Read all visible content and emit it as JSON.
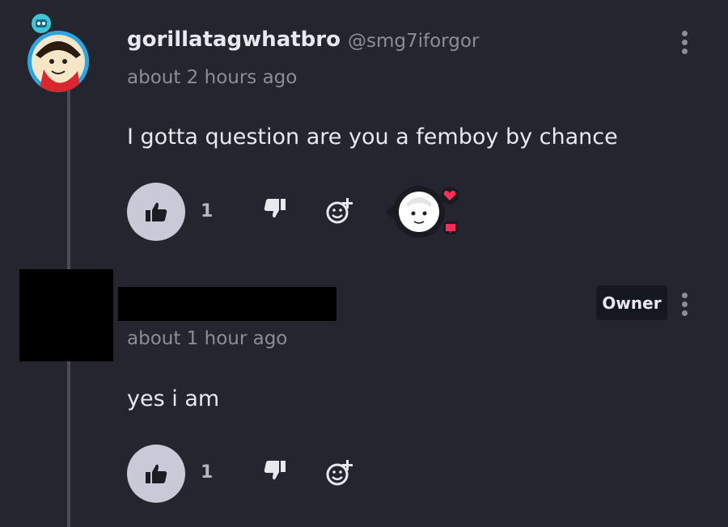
{
  "comments": [
    {
      "username": "gorillatagwhatbro",
      "handle": "@smg7iforgor",
      "time": "about 2 hours ago",
      "text": "I gotta question are you a femboy by chance",
      "like_count": "1"
    },
    {
      "badge": "Owner",
      "time": "about 1 hour ago",
      "text": "yes i am",
      "like_count": "1"
    }
  ],
  "colors": {
    "background": "#24252e",
    "text_primary": "#e8e8ee",
    "text_muted": "#8c8d96",
    "like_button": "#c8cad8",
    "heart_accent": "#ff2d55"
  },
  "icons": [
    "thumbs-up-icon",
    "thumbs-down-icon",
    "add-reaction-icon",
    "kebab-menu-icon",
    "heart-icon"
  ]
}
